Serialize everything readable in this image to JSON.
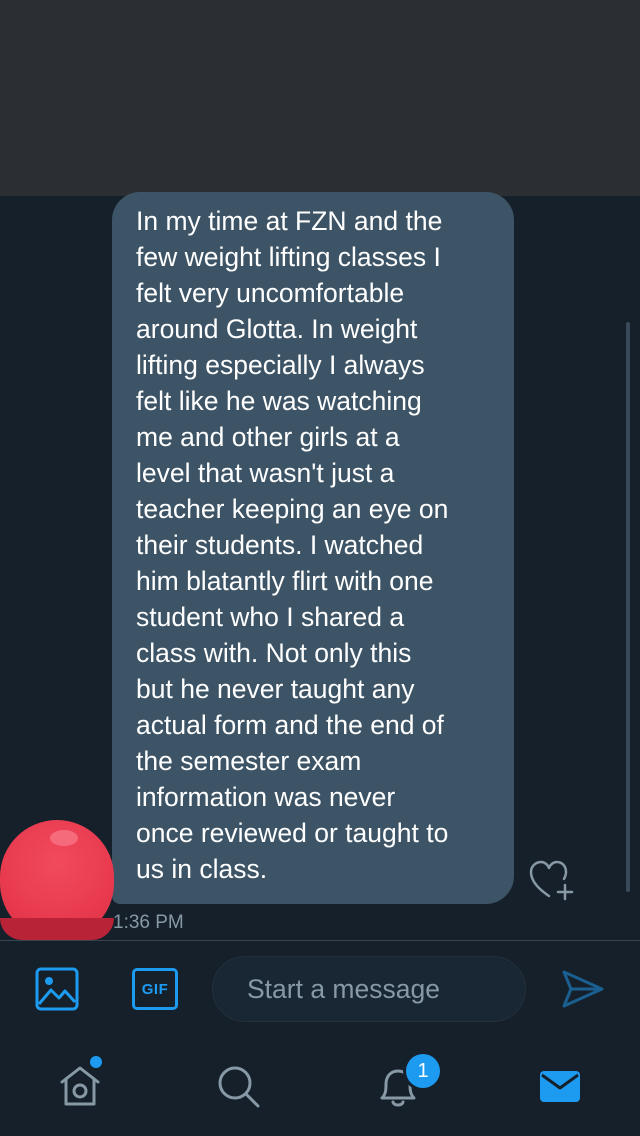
{
  "message": {
    "text": "In my time at FZN and the\nfew weight lifting classes I\nfelt very uncomfortable\naround Glotta. In weight\nlifting especially I always\nfelt like he was watching\nme and other girls at a\nlevel that wasn't just a\nteacher keeping an eye on\ntheir students. I watched\nhim blatantly flirt with one\nstudent who I shared a\nclass with. Not only this\nbut he never taught any\nactual form and the end of\nthe semester exam\ninformation was never\nonce reviewed or taught to\nus in class.",
    "time": "1:36 PM"
  },
  "composer": {
    "gif_label": "GIF",
    "placeholder": "Start a message"
  },
  "tabbar": {
    "items": [
      {
        "icon": "home-icon",
        "has_dot": true
      },
      {
        "icon": "search-icon"
      },
      {
        "icon": "bell-icon",
        "badge": "1"
      },
      {
        "icon": "mail-icon",
        "active": true
      }
    ]
  },
  "colors": {
    "background": "#15202b",
    "bubble": "#3d5466",
    "accent": "#1d9bf0",
    "secondary_text": "#8899a6",
    "avatar": "#e83a4f"
  }
}
